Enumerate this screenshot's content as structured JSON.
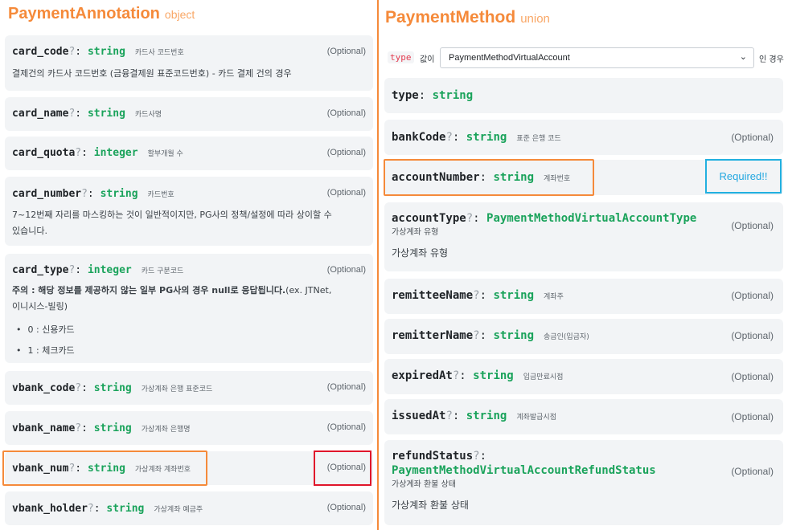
{
  "left": {
    "title": "PaymentAnnotation",
    "kind": "object",
    "optional_label": "(Optional)",
    "fields": [
      {
        "name": "card_code",
        "q": "?",
        "type": "string",
        "kor": "카드사 코드번호",
        "desc": "결제건의 카드사 코드번호 (금융결제원 표준코드번호) - 카드 결제 건의 경우"
      },
      {
        "name": "card_name",
        "q": "?",
        "type": "string",
        "kor": "카드사명"
      },
      {
        "name": "card_quota",
        "q": "?",
        "type": "integer",
        "kor": "할부개월 수"
      },
      {
        "name": "card_number",
        "q": "?",
        "type": "string",
        "kor": "카드번호",
        "desc1": "7~12번째 자리를 마스킹하는 것이 일반적이지만, PG사의 정책/설정에 따라 상이할 수",
        "desc2": "있습니다."
      },
      {
        "name": "card_type",
        "q": "?",
        "type": "integer",
        "kor": "카드 구분코드",
        "desc1_bold": "주의 : 해당 정보를 제공하지 않는 일부 PG사의 경우 null로 응답됩니다.",
        "desc1_rest": "(ex. JTNet,",
        "desc2": "이니시스-빌링)",
        "bullets": [
          "0 : 신용카드",
          "1 : 체크카드"
        ]
      },
      {
        "name": "vbank_code",
        "q": "?",
        "type": "string",
        "kor": "가상계좌 은행 표준코드"
      },
      {
        "name": "vbank_name",
        "q": "?",
        "type": "string",
        "kor": "가상계좌 은행명"
      },
      {
        "name": "vbank_num",
        "q": "?",
        "type": "string",
        "kor": "가상계좌 계좌번호"
      },
      {
        "name": "vbank_holder",
        "q": "?",
        "type": "string",
        "kor": "가상계좌 예금주"
      }
    ]
  },
  "right": {
    "title": "PaymentMethod",
    "kind": "union",
    "type_chip": "type",
    "type_kor": "값이",
    "select_value": "PaymentMethodVirtualAccount",
    "type_after": "인 경우",
    "optional_label": "(Optional)",
    "required_label": "Required!!",
    "fields": [
      {
        "name": "type",
        "q": "",
        "type": "string"
      },
      {
        "name": "bankCode",
        "q": "?",
        "type": "string",
        "kor": "표준 은행 코드"
      },
      {
        "name": "accountNumber",
        "q": "",
        "type": "string",
        "kor": "계좌번호"
      },
      {
        "name": "accountType",
        "q": "?",
        "type": "PaymentMethodVirtualAccountType",
        "kor_line": "가상계좌 유형",
        "desc": "가상계좌 유형"
      },
      {
        "name": "remitteeName",
        "q": "?",
        "type": "string",
        "kor": "계좌주"
      },
      {
        "name": "remitterName",
        "q": "?",
        "type": "string",
        "kor": "송금인(입금자)"
      },
      {
        "name": "expiredAt",
        "q": "?",
        "type": "string",
        "kor": "입금만료시점"
      },
      {
        "name": "issuedAt",
        "q": "?",
        "type": "string",
        "kor": "계좌발급시점"
      },
      {
        "name": "refundStatus",
        "q": "?",
        "type": "PaymentMethodVirtualAccountRefundStatus",
        "kor_line": "가상계좌 환불 상태",
        "desc": "가상계좌 환불 상태"
      }
    ]
  },
  "colors": {
    "accent_orange": "#f58a3a",
    "type_green": "#1aa35b",
    "highlight_red": "#e0162b",
    "highlight_blue": "#22b0e0"
  }
}
